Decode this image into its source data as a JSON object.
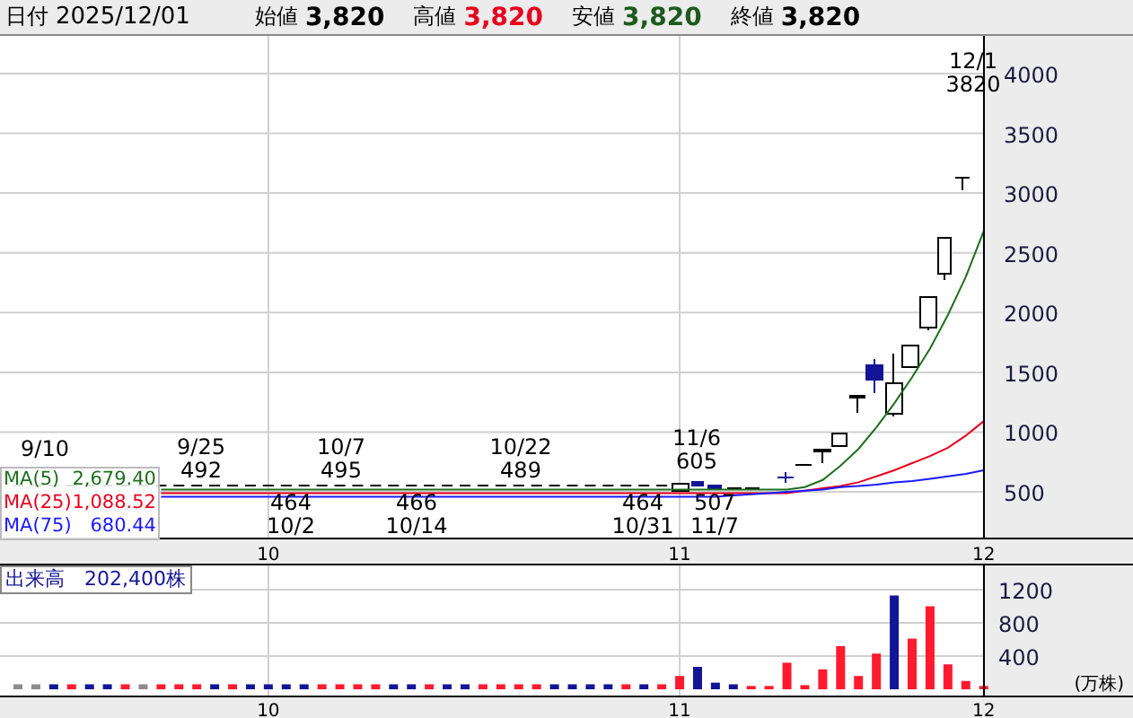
{
  "header": {
    "date_label": "日付",
    "date": "2025/12/01",
    "fields": [
      {
        "label": "始値",
        "value": "3,820",
        "color": "#000000"
      },
      {
        "label": "高値",
        "value": "3,820",
        "color": "#e8001c"
      },
      {
        "label": "安値",
        "value": "3,820",
        "color": "#1e5a1e"
      },
      {
        "label": "終値",
        "value": "3,820",
        "color": "#000000"
      }
    ]
  },
  "price_chart": {
    "chart_data": {
      "type": "line",
      "categories": [
        null,
        null,
        null,
        null,
        null,
        null,
        null,
        null,
        null,
        null,
        null,
        null,
        null,
        null,
        "10",
        null,
        null,
        null,
        null,
        null,
        null,
        null,
        null,
        null,
        null,
        null,
        null,
        null,
        null,
        null,
        null,
        null,
        null,
        null,
        null,
        null,
        null,
        "11",
        null,
        null,
        null,
        null,
        null,
        null,
        null,
        null,
        null,
        null,
        null,
        null,
        null,
        null,
        null,
        null,
        "12"
      ],
      "series": [
        {
          "name": "MA(5)",
          "color": "#1e6e1e",
          "values": [
            null,
            null,
            null,
            null,
            null,
            null,
            null,
            null,
            520,
            520,
            520,
            520,
            520,
            520,
            520,
            520,
            520,
            520,
            520,
            520,
            520,
            520,
            520,
            520,
            520,
            520,
            520,
            520,
            520,
            520,
            520,
            520,
            520,
            520,
            520,
            520,
            520,
            520,
            520,
            520,
            520,
            520,
            520,
            520,
            540,
            600,
            720,
            860,
            1040,
            1240,
            1460,
            1700,
            1980,
            2300,
            2680
          ]
        },
        {
          "name": "MA(25)",
          "color": "#e8001c",
          "values": [
            null,
            null,
            null,
            null,
            null,
            null,
            null,
            null,
            490,
            490,
            490,
            490,
            490,
            490,
            490,
            490,
            490,
            490,
            490,
            490,
            490,
            490,
            490,
            490,
            490,
            490,
            490,
            490,
            490,
            490,
            490,
            490,
            490,
            490,
            490,
            490,
            490,
            490,
            490,
            490,
            490,
            490,
            490,
            490,
            510,
            530,
            550,
            580,
            630,
            680,
            740,
            800,
            870,
            970,
            1090
          ]
        },
        {
          "name": "MA(75)",
          "color": "#1a1aff",
          "values": [
            null,
            null,
            null,
            null,
            null,
            null,
            null,
            null,
            460,
            460,
            460,
            460,
            460,
            460,
            460,
            460,
            460,
            460,
            460,
            460,
            460,
            460,
            460,
            460,
            460,
            460,
            460,
            460,
            460,
            460,
            460,
            460,
            460,
            460,
            460,
            460,
            460,
            460,
            460,
            460,
            470,
            480,
            490,
            500,
            510,
            520,
            540,
            550,
            560,
            580,
            590,
            610,
            630,
            650,
            680
          ]
        }
      ],
      "ylim": [
        110,
        4315
      ],
      "grid": true,
      "yticks": [
        500,
        1000,
        1500,
        2000,
        2500,
        3000,
        3500,
        4000
      ]
    },
    "labels": [
      {
        "kind": "above",
        "lines": [
          "9/10"
        ]
      },
      {
        "kind": "above",
        "lines": [
          "9/25",
          "492"
        ]
      },
      {
        "kind": "above",
        "lines": [
          "10/7",
          "495"
        ]
      },
      {
        "kind": "above",
        "lines": [
          "10/22",
          "489"
        ]
      },
      {
        "kind": "above",
        "lines": [
          "11/6",
          "605"
        ]
      },
      {
        "kind": "above",
        "lines": [
          "12/1",
          "3820"
        ]
      },
      {
        "kind": "below",
        "lines": [
          "464",
          "10/2"
        ]
      },
      {
        "kind": "below",
        "lines": [
          "466",
          "10/14"
        ]
      },
      {
        "kind": "below",
        "lines": [
          "464",
          "10/31"
        ]
      },
      {
        "kind": "below",
        "lines": [
          "507",
          "11/7"
        ]
      }
    ],
    "legend": [
      {
        "value": "2,679.40"
      },
      {
        "value": "1,088.52"
      },
      {
        "value": "680.44"
      }
    ]
  },
  "volume_chart": {
    "label": "出来高　202,400株",
    "unit": "(万株)",
    "chart_data": {
      "type": "bar",
      "stacked": true,
      "categories": [
        null,
        null,
        null,
        null,
        null,
        null,
        null,
        null,
        null,
        null,
        null,
        null,
        null,
        null,
        "10",
        null,
        null,
        null,
        null,
        null,
        null,
        null,
        null,
        null,
        null,
        null,
        null,
        null,
        null,
        null,
        null,
        null,
        null,
        null,
        null,
        null,
        null,
        "11",
        null,
        null,
        null,
        null,
        null,
        null,
        null,
        null,
        null,
        null,
        null,
        null,
        null,
        null,
        null,
        null,
        "12"
      ],
      "series": [
        {
          "color": "#ff1a2e",
          "values": [
            null,
            null,
            null,
            60,
            null,
            null,
            60,
            null,
            60,
            60,
            60,
            null,
            60,
            null,
            null,
            null,
            null,
            60,
            60,
            60,
            60,
            null,
            null,
            60,
            null,
            null,
            60,
            60,
            60,
            60,
            null,
            null,
            null,
            null,
            60,
            null,
            60,
            160,
            null,
            null,
            null,
            40,
            40,
            320,
            50,
            240,
            520,
            160,
            430,
            null,
            610,
            1000,
            300,
            100,
            40
          ]
        },
        {
          "color": "#141496",
          "values": [
            null,
            null,
            60,
            null,
            60,
            60,
            null,
            null,
            null,
            null,
            null,
            60,
            null,
            60,
            60,
            60,
            60,
            null,
            null,
            null,
            null,
            60,
            60,
            null,
            60,
            60,
            null,
            null,
            null,
            null,
            60,
            60,
            60,
            60,
            null,
            60,
            null,
            null,
            270,
            80,
            60,
            null,
            null,
            null,
            null,
            null,
            null,
            null,
            null,
            1130,
            null,
            null,
            null,
            null,
            null
          ]
        },
        {
          "color": "#8c8c8c",
          "values": [
            60,
            60,
            null,
            null,
            null,
            null,
            null,
            60,
            null,
            null,
            null,
            null,
            null,
            null,
            null,
            null,
            null,
            null,
            null,
            null,
            null,
            null,
            null,
            null,
            null,
            null,
            null,
            null,
            null,
            null,
            null,
            null,
            null,
            null,
            null,
            null,
            null,
            null,
            null,
            null,
            null,
            null,
            null,
            null,
            null,
            null,
            null,
            null,
            null,
            null,
            null,
            null,
            null,
            null,
            null
          ]
        }
      ],
      "ylim": [
        0,
        1514
      ],
      "yticks": [
        400,
        800,
        1200
      ],
      "grid": true
    }
  }
}
